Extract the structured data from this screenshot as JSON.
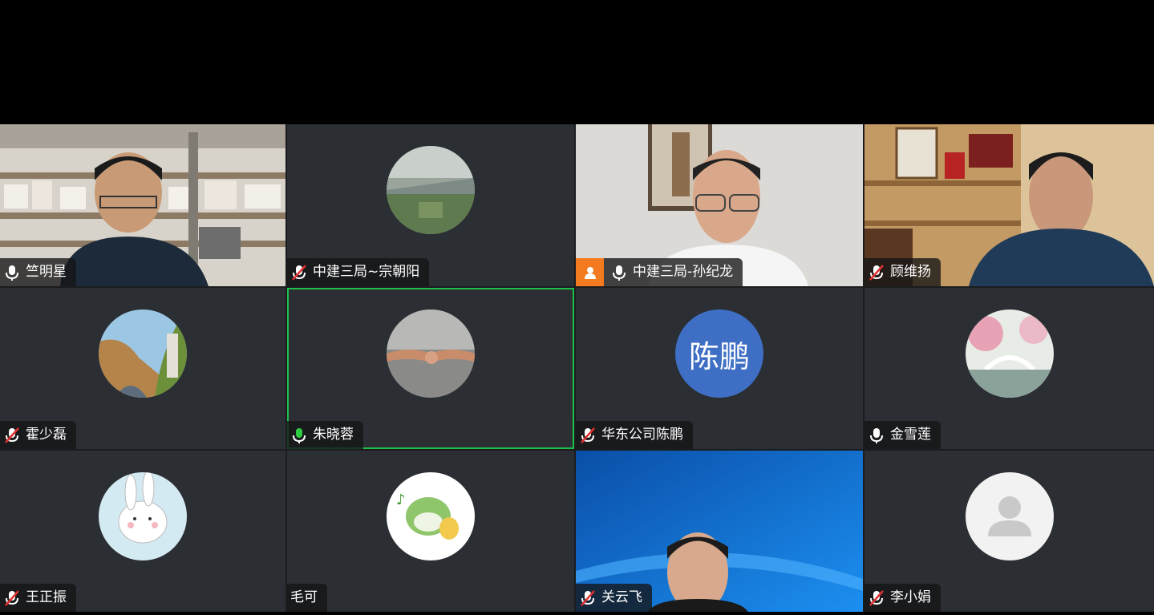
{
  "participants": [
    {
      "name": "竺明星",
      "mic": "on"
    },
    {
      "name": "中建三局~宗朝阳",
      "mic": "muted"
    },
    {
      "name": "中建三局-孙纪龙",
      "mic": "on",
      "badge": "user-icon"
    },
    {
      "name": "顾维扬",
      "mic": "muted"
    },
    {
      "name": "霍少磊",
      "mic": "muted"
    },
    {
      "name": "朱晓蓉",
      "mic": "active",
      "speaking": true
    },
    {
      "name": "华东公司陈鹏",
      "mic": "muted",
      "avatar_text": "陈鹏"
    },
    {
      "name": "金雪莲",
      "mic": "on"
    },
    {
      "name": "王正振",
      "mic": "muted"
    },
    {
      "name": "毛可",
      "mic": "none"
    },
    {
      "name": "关云飞",
      "mic": "muted"
    },
    {
      "name": "李小娟",
      "mic": "muted"
    }
  ],
  "colors": {
    "tile_bg": "#2b2e33",
    "speaking_border": "#1fbf4a",
    "initials_avatar": "#3e6fc4",
    "badge_orange": "#f37a1f",
    "mic_active": "#2ecc40",
    "mic_muted": "#e03131"
  }
}
